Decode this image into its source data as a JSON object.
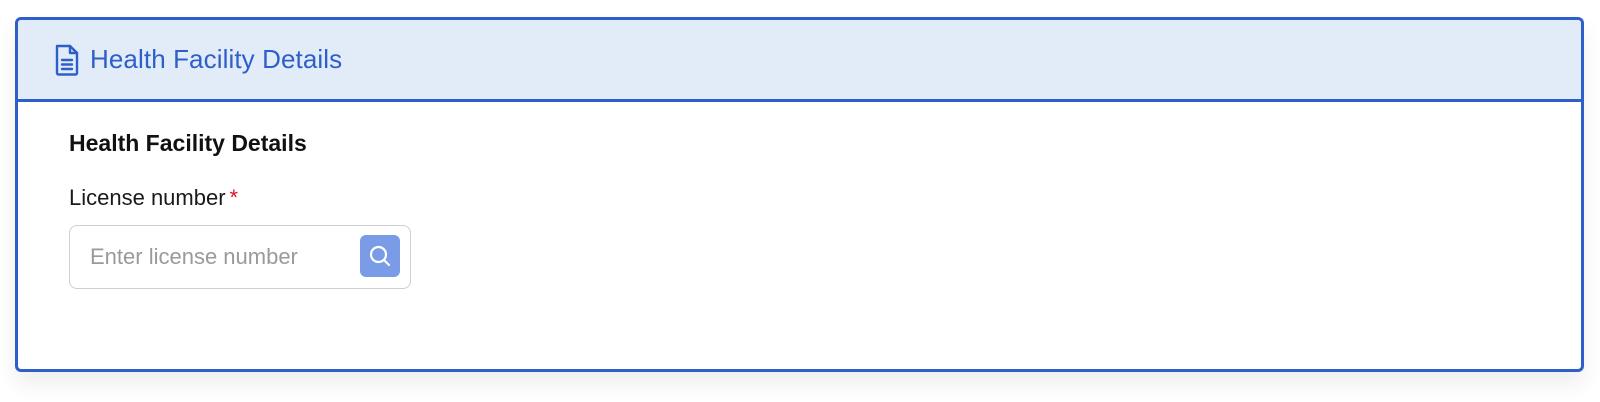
{
  "header": {
    "title": "Health Facility Details",
    "icon": "file-text-icon"
  },
  "section": {
    "title": "Health Facility Details"
  },
  "license_field": {
    "label": "License number",
    "required_marker": "*",
    "value": "",
    "placeholder": "Enter license number",
    "button_icon": "search-icon"
  },
  "colors": {
    "accent": "#2d5ec9",
    "header_bg": "#e1ecf8",
    "search_button_bg": "#7a9be6",
    "required": "#d9142b"
  }
}
